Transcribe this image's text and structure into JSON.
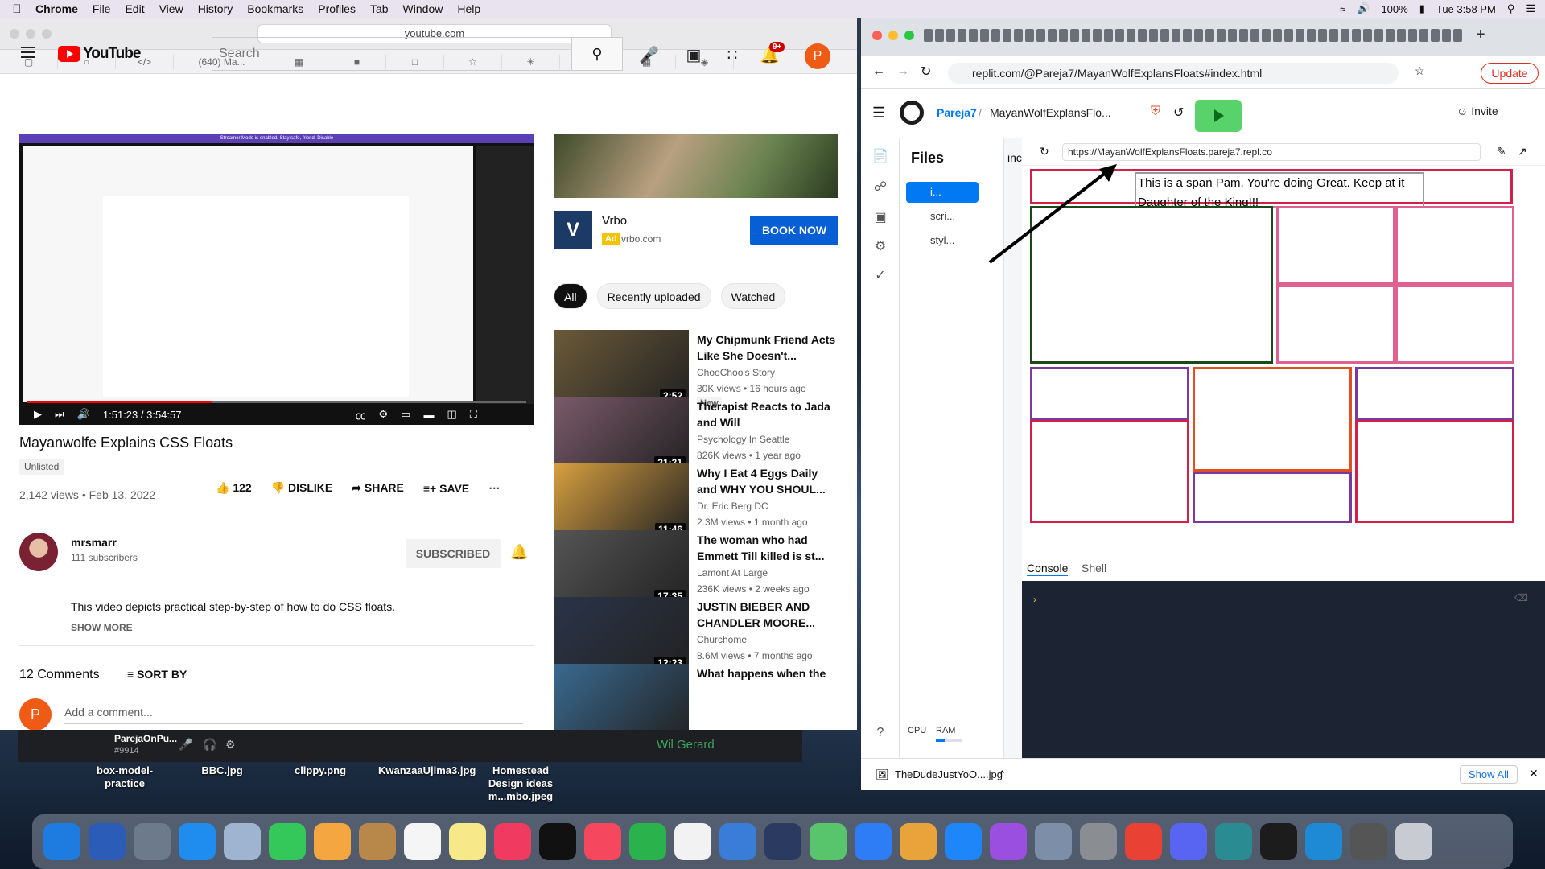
{
  "menubar": {
    "app": "Chrome",
    "items": [
      "File",
      "Edit",
      "View",
      "History",
      "Bookmarks",
      "Profiles",
      "Tab",
      "Window",
      "Help"
    ],
    "battery": "100%",
    "clock": "Tue 3:58 PM"
  },
  "left_browser": {
    "address": "youtube.com",
    "bookmark_tab": "(640) Ma..."
  },
  "youtube": {
    "search_placeholder": "Search",
    "notif_count": "9+",
    "avatar_letter": "P",
    "video": {
      "banner": "Streamer Mode is enabled. Stay safe, friend.  Disable",
      "time": "1:51:23 / 3:54:57",
      "progress_fraction": 0.37
    },
    "title": "Mayanwolfe Explains CSS Floats",
    "badge": "Unlisted",
    "views": "2,142 views • Feb 13, 2022",
    "likes": "122",
    "dislike": "DISLIKE",
    "share": "SHARE",
    "save": "SAVE",
    "channel": {
      "name": "mrsmarr",
      "subs": "111 subscribers",
      "subscribed": "SUBSCRIBED"
    },
    "description": "This video depicts practical step-by-step of how to do CSS floats.",
    "show_more": "SHOW MORE",
    "comments_count": "12 Comments",
    "sort_by": "SORT BY",
    "add_comment": "Add a comment...",
    "ad": {
      "title": "Vrbo",
      "badge": "Ad",
      "url": "vrbo.com",
      "cta": "BOOK NOW",
      "logo": "V"
    },
    "chips": [
      "All",
      "Recently uploaded",
      "Watched"
    ],
    "recommendations": [
      {
        "title": "My Chipmunk Friend Acts Like She Doesn't...",
        "channel": "ChooChoo's Story",
        "meta": "30K views • 16 hours ago",
        "duration": "2:52",
        "badge": "New",
        "color": "#6b5a3a"
      },
      {
        "title": "Therapist Reacts to Jada and Will",
        "channel": "Psychology In Seattle",
        "meta": "826K views • 1 year ago",
        "duration": "21:31",
        "badge": "",
        "color": "#7a5a6a"
      },
      {
        "title": "Why I Eat 4 Eggs Daily and WHY YOU SHOUL...",
        "channel": "Dr. Eric Berg DC",
        "meta": "2.3M views • 1 month ago",
        "duration": "11:46",
        "badge": "",
        "color": "#d8a040"
      },
      {
        "title": "The woman who had Emmett Till killed is st...",
        "channel": "Lamont At Large",
        "meta": "236K views • 2 weeks ago",
        "duration": "17:35",
        "badge": "",
        "color": "#555"
      },
      {
        "title": "JUSTIN BIEBER AND CHANDLER MOORE...",
        "channel": "Churchome",
        "meta": "8.6M views • 7 months ago",
        "duration": "12:23",
        "badge": "",
        "color": "#2a3448"
      },
      {
        "title": "What happens when the",
        "channel": "",
        "meta": "",
        "duration": "",
        "badge": "",
        "color": "#3a6a90"
      }
    ]
  },
  "right_browser": {
    "address": "replit.com/@Pareja7/MayanWolfExplansFloats#index.html",
    "update": "Update",
    "user": "Pareja7",
    "repl": "MayanWolfExplansFlo...",
    "invite": "Invite",
    "files_title": "Files",
    "files": [
      "i...",
      "scri...",
      "styl..."
    ],
    "file_tab": "inc",
    "cpu": "CPU",
    "ram": "RAM",
    "ram_usage": 0.35,
    "webview_url": "https://MayanWolfExplansFloats.pareja7.repl.co",
    "span_text": "This is a span Pam. You're doing Great. Keep at it Daughter of the King!!!",
    "console_tab": "Console",
    "shell_tab": "Shell",
    "download": "TheDudeJustYoO....jpg",
    "show_all": "Show All"
  },
  "desktop": {
    "discord_user": "ParejaOnPu...",
    "discord_tag": "#9914",
    "discord_name": "Wil Gerard",
    "icons": [
      "box-model-practice",
      "BBC.jpg",
      "clippy.png",
      "KwanzaaUjima3.jpg",
      "Homestead Design ideas m...mbo.jpeg"
    ]
  }
}
